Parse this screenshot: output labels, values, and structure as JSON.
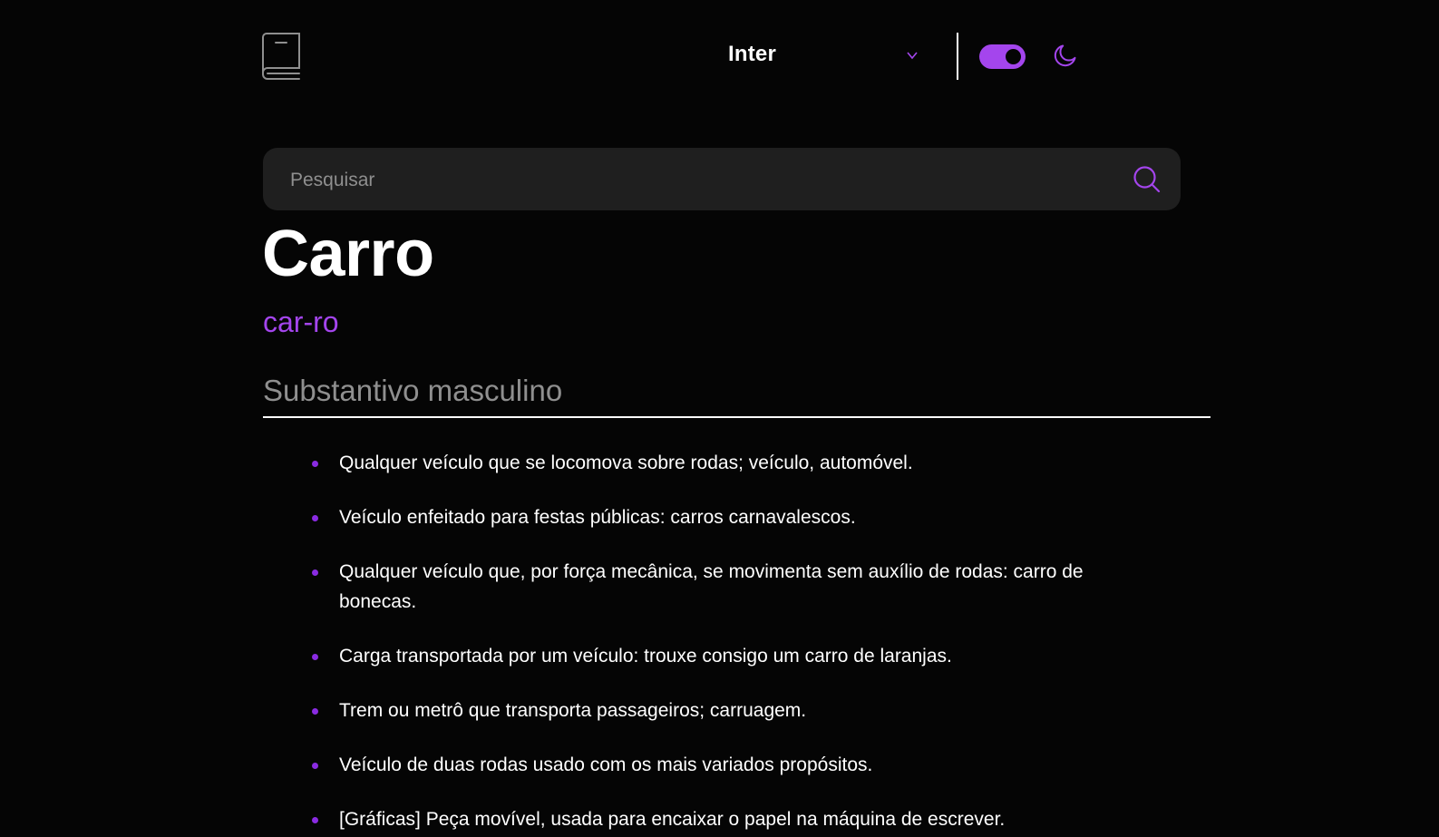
{
  "header": {
    "font_selector": {
      "selected": "Inter"
    },
    "theme": {
      "dark_mode": true
    }
  },
  "search": {
    "placeholder": "Pesquisar",
    "value": ""
  },
  "entry": {
    "word": "Carro",
    "phonetic": "car-ro",
    "part_of_speech": "Substantivo masculino",
    "definitions": [
      "Qualquer veículo que se locomova sobre rodas; veículo, automóvel.",
      "Veículo enfeitado para festas públicas: carros carnavalescos.",
      "Qualquer veículo que, por força mecânica, se movimenta sem auxílio de rodas: carro de bonecas.",
      "Carga transportada por um veículo: trouxe consigo um carro de laranjas.",
      "Trem ou metrô que transporta passageiros; carruagem.",
      "Veículo de duas rodas usado com os mais variados propósitos.",
      "[Gráficas] Peça movível, usada para encaixar o papel na máquina de escrever."
    ]
  },
  "colors": {
    "accent": "#a445ed",
    "background": "#050505",
    "search_bg": "#1f1f1f",
    "muted_text": "#8f8f8f"
  },
  "icons": [
    "book-icon",
    "chevron-down-icon",
    "moon-icon",
    "search-icon"
  ]
}
